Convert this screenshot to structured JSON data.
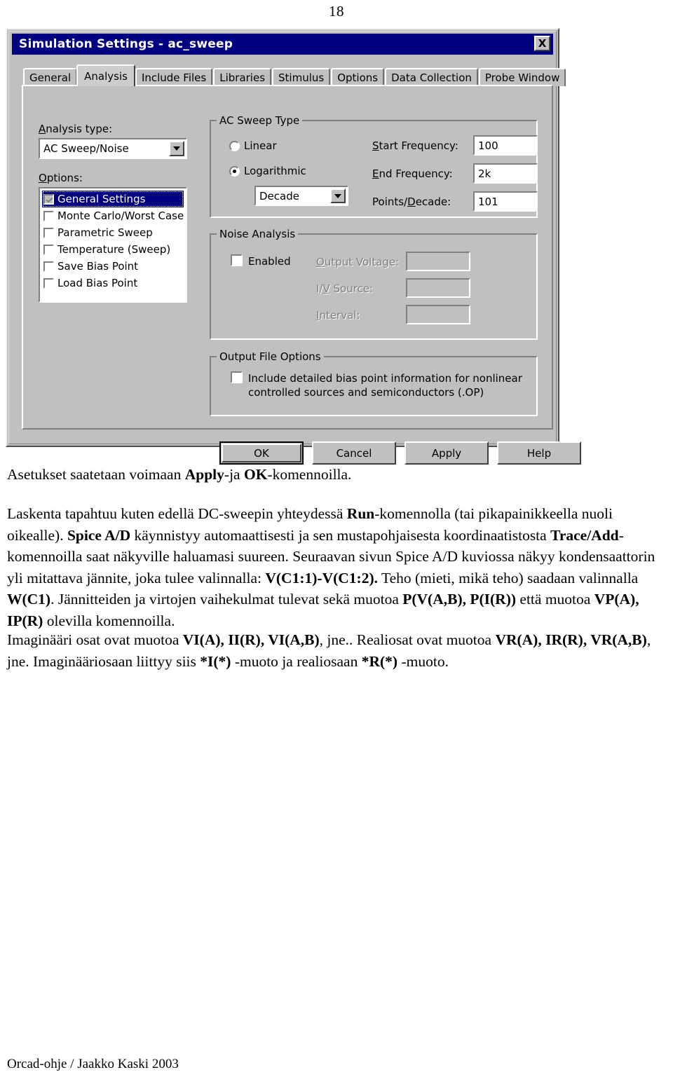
{
  "page": {
    "number": "18",
    "footer": "Orcad-ohje / Jaakko Kaski 2003"
  },
  "dialog": {
    "title": "Simulation Settings - ac_sweep",
    "close_label": "X",
    "tabs": [
      {
        "label": "General",
        "active": false
      },
      {
        "label": "Analysis",
        "active": true
      },
      {
        "label": "Include Files",
        "active": false
      },
      {
        "label": "Libraries",
        "active": false
      },
      {
        "label": "Stimulus",
        "active": false
      },
      {
        "label": "Options",
        "active": false
      },
      {
        "label": "Data Collection",
        "active": false
      },
      {
        "label": "Probe Window",
        "active": false
      }
    ],
    "analysis_type": {
      "label": "Analysis type:",
      "value": "AC Sweep/Noise"
    },
    "options": {
      "label": "Options:",
      "items": [
        {
          "label": "General Settings",
          "checked": true,
          "selected": true
        },
        {
          "label": "Monte Carlo/Worst Case",
          "checked": false,
          "selected": false
        },
        {
          "label": "Parametric Sweep",
          "checked": false,
          "selected": false
        },
        {
          "label": "Temperature (Sweep)",
          "checked": false,
          "selected": false
        },
        {
          "label": "Save Bias Point",
          "checked": false,
          "selected": false
        },
        {
          "label": "Load Bias Point",
          "checked": false,
          "selected": false
        }
      ]
    },
    "ac_sweep_type": {
      "legend": "AC Sweep Type",
      "radio_linear": "Linear",
      "radio_logarithmic": "Logarithmic",
      "selected_radio": "Logarithmic",
      "scale_value": "Decade",
      "start_frequency_label": "Start Frequency:",
      "start_frequency_value": "100",
      "end_frequency_label": "End Frequency:",
      "end_frequency_value": "2k",
      "points_per_decade_label": "Points/Decade:",
      "points_per_decade_value": "101"
    },
    "noise_analysis": {
      "legend": "Noise Analysis",
      "enabled_label": "Enabled",
      "enabled_checked": false,
      "output_voltage_label": "Output Voltage:",
      "output_voltage_value": "",
      "iv_source_label": "I/V Source:",
      "iv_source_value": "",
      "interval_label": "Interval:",
      "interval_value": ""
    },
    "output_file_options": {
      "legend": "Output File Options",
      "include_checkbox_line1": "Include detailed bias point information for nonlinear",
      "include_checkbox_line2": "controlled sources and semiconductors (.OP)",
      "include_checked": false
    },
    "buttons": {
      "ok": "OK",
      "cancel": "Cancel",
      "apply": "Apply",
      "help": "Help"
    }
  },
  "body": {
    "p1": {
      "a": "Asetukset saatetaan voimaan ",
      "b1": "Apply",
      "c": "-ja ",
      "b2": "OK",
      "d": "-komennoilla."
    },
    "p2": {
      "a": "Laskenta tapahtuu kuten edellä DC-sweepin yhteydessä ",
      "b1": "Run",
      "c": "-komennolla (tai pikapainikkeella nuoli oikealle). ",
      "b2": "Spice A/D",
      "d": " käynnistyy automaattisesti ja sen mustapohjaisesta koordinaatistosta ",
      "b3": "Trace/Add",
      "e": "-komennoilla saat näkyville haluamasi suureen. Seuraavan sivun Spice A/D kuviossa näkyy kondensaattorin yli mitattava jännite, joka tulee valinnalla: ",
      "b4": "V(C1:1)-V(C1:2).",
      "f": " Teho (mieti, mikä teho) saadaan valinnalla ",
      "b5": "W(C1)",
      "g": ". Jännitteiden ja virtojen vaihekulmat tulevat sekä muotoa ",
      "b6": "P(V(A,B), P(I(R))",
      "h": " että muotoa ",
      "b7": "VP(A), IP(R)",
      "i": " olevilla komennoilla."
    },
    "p3": {
      "a": "Imaginääri osat ovat muotoa ",
      "b1": "VI(A), II(R), VI(A,B)",
      "c": ", jne.. Realiosat ovat muotoa ",
      "b2": "VR(A), IR(R), VR(A,B)",
      "d": ", jne. Imaginääriosaan liittyy siis ",
      "b3": "*I(*)",
      "e": " -muoto ja realiosaan ",
      "b4": "*R(*)",
      "f": " -muoto."
    }
  }
}
